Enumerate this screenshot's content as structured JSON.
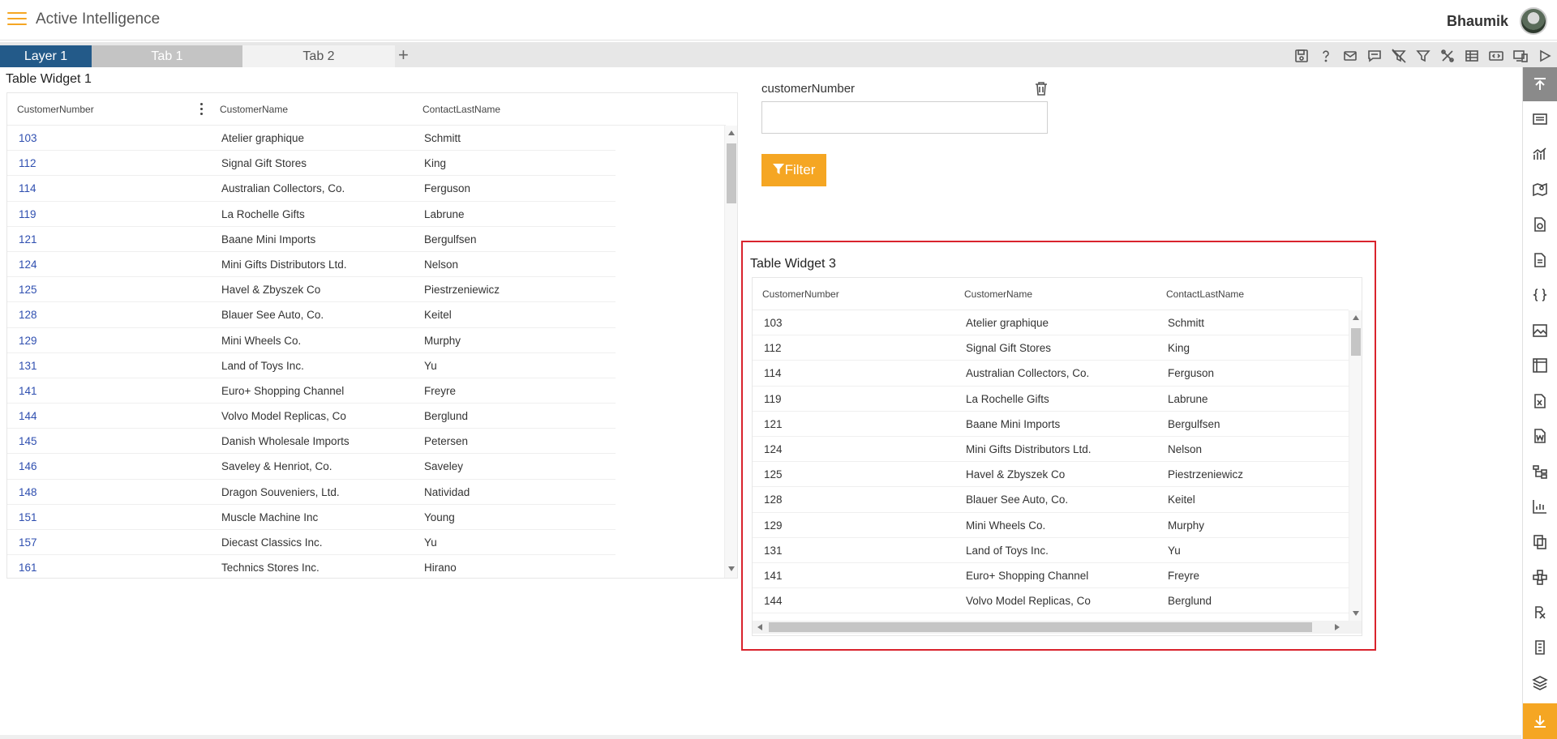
{
  "header": {
    "title": "Active Intelligence",
    "username": "Bhaumik"
  },
  "tabs": {
    "layer": "Layer 1",
    "tab1": "Tab 1",
    "tab2": "Tab 2",
    "add": "+"
  },
  "toolbar_icons": [
    "save-icon",
    "help-icon",
    "mail-icon",
    "comment-icon",
    "clear-filter-icon",
    "filter-icon",
    "tools-icon",
    "table-icon",
    "embed-icon",
    "device-icon",
    "play-icon"
  ],
  "sidebar_icons": [
    "scroll-top-icon",
    "card-icon",
    "chart-icon",
    "map-icon",
    "image-file-icon",
    "document-icon",
    "code-icon",
    "picture-icon",
    "pivot-icon",
    "excel-icon",
    "word-icon",
    "tree-icon",
    "line-chart-icon",
    "copy-icon",
    "cluster-icon",
    "rx-icon",
    "report-icon",
    "layers-icon",
    "download-icon"
  ],
  "widget1": {
    "title": "Table Widget 1",
    "columns": [
      "CustomerNumber",
      "CustomerName",
      "ContactLastName"
    ],
    "rows": [
      [
        "103",
        "Atelier graphique",
        "Schmitt"
      ],
      [
        "112",
        "Signal Gift Stores",
        "King"
      ],
      [
        "114",
        "Australian Collectors, Co.",
        "Ferguson"
      ],
      [
        "119",
        "La Rochelle Gifts",
        "Labrune"
      ],
      [
        "121",
        "Baane Mini Imports",
        "Bergulfsen"
      ],
      [
        "124",
        "Mini Gifts Distributors Ltd.",
        "Nelson"
      ],
      [
        "125",
        "Havel & Zbyszek Co",
        "Piestrzeniewicz"
      ],
      [
        "128",
        "Blauer See Auto, Co.",
        "Keitel"
      ],
      [
        "129",
        "Mini Wheels Co.",
        "Murphy"
      ],
      [
        "131",
        "Land of Toys Inc.",
        "Yu"
      ],
      [
        "141",
        "Euro+ Shopping Channel",
        "Freyre"
      ],
      [
        "144",
        "Volvo Model Replicas, Co",
        "Berglund"
      ],
      [
        "145",
        "Danish Wholesale Imports",
        "Petersen"
      ],
      [
        "146",
        "Saveley & Henriot, Co.",
        "Saveley"
      ],
      [
        "148",
        "Dragon Souveniers, Ltd.",
        "Natividad"
      ],
      [
        "151",
        "Muscle Machine Inc",
        "Young"
      ],
      [
        "157",
        "Diecast Classics Inc.",
        "Yu"
      ],
      [
        "161",
        "Technics Stores Inc.",
        "Hirano"
      ]
    ]
  },
  "filter": {
    "label": "customerNumber",
    "value": "",
    "button": "Filter"
  },
  "widget3": {
    "title": "Table Widget 3",
    "columns": [
      "CustomerNumber",
      "CustomerName",
      "ContactLastName"
    ],
    "rows": [
      [
        "103",
        "Atelier graphique",
        "Schmitt"
      ],
      [
        "112",
        "Signal Gift Stores",
        "King"
      ],
      [
        "114",
        "Australian Collectors, Co.",
        "Ferguson"
      ],
      [
        "119",
        "La Rochelle Gifts",
        "Labrune"
      ],
      [
        "121",
        "Baane Mini Imports",
        "Bergulfsen"
      ],
      [
        "124",
        "Mini Gifts Distributors Ltd.",
        "Nelson"
      ],
      [
        "125",
        "Havel & Zbyszek Co",
        "Piestrzeniewicz"
      ],
      [
        "128",
        "Blauer See Auto, Co.",
        "Keitel"
      ],
      [
        "129",
        "Mini Wheels Co.",
        "Murphy"
      ],
      [
        "131",
        "Land of Toys Inc.",
        "Yu"
      ],
      [
        "141",
        "Euro+ Shopping Channel",
        "Freyre"
      ],
      [
        "144",
        "Volvo Model Replicas, Co",
        "Berglund"
      ]
    ]
  },
  "colors": {
    "accent": "#f5a623",
    "layer_tab": "#235a89",
    "link": "#2f4fb0",
    "highlight": "#d9232d"
  }
}
